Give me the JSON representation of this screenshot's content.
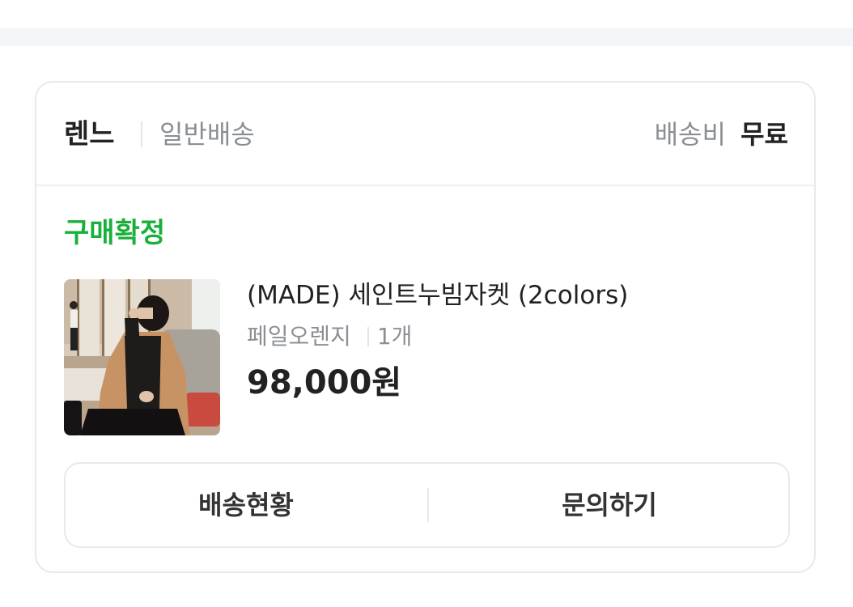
{
  "order_card": {
    "seller_name": "렌느",
    "shipping_type": "일반배송",
    "shipping_fee_label": "배송비",
    "shipping_fee_value": "무료",
    "status": "구매확정",
    "status_color": "#18b03b",
    "product": {
      "name": "(MADE) 세인트누빔자켓 (2colors)",
      "option": "페일오렌지",
      "quantity": "1개",
      "price": "98,000원"
    },
    "actions": {
      "track_label": "배송현황",
      "inquiry_label": "문의하기"
    }
  }
}
